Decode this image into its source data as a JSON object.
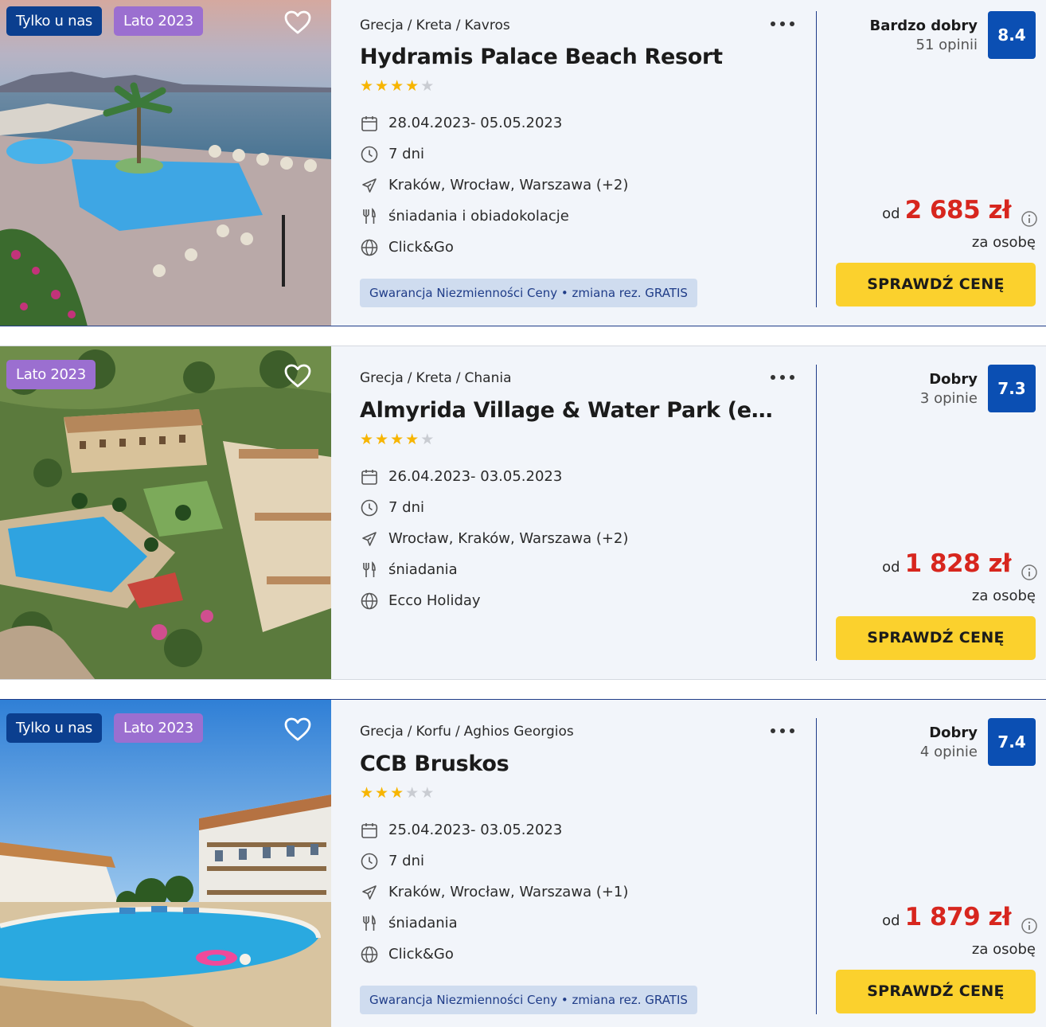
{
  "offers": [
    {
      "badges": [
        "Tylko u nas",
        "Lato 2023"
      ],
      "breadcrumb": [
        "Grecja",
        "Kreta",
        "Kavros"
      ],
      "title": "Hydramis Palace Beach Resort",
      "stars": 4,
      "dates": "28.04.2023- 05.05.2023",
      "duration": "7 dni",
      "departure": "Kraków, Wrocław, Warszawa  (+2)",
      "board": "śniadania i obiadokolacje",
      "operator": "Click&Go",
      "guarantee": "Gwarancja Niezmienności Ceny • zmiana rez. GRATIS",
      "rating_label": "Bardzo dobry",
      "rating_count": "51 opinii",
      "score": "8.4",
      "price_prefix": "od",
      "price": "2 685 zł",
      "price_note": "za osobę",
      "cta": "SPRAWDŹ CENĘ"
    },
    {
      "badges": [
        "Lato 2023"
      ],
      "breadcrumb": [
        "Grecja",
        "Kreta",
        "Chania"
      ],
      "title": "Almyrida Village & Water Park (ex. L...",
      "stars": 4,
      "dates": "26.04.2023- 03.05.2023",
      "duration": "7 dni",
      "departure": "Wrocław, Kraków, Warszawa  (+2)",
      "board": "śniadania",
      "operator": "Ecco Holiday",
      "guarantee": "",
      "rating_label": "Dobry",
      "rating_count": "3 opinie",
      "score": "7.3",
      "price_prefix": "od",
      "price": "1 828 zł",
      "price_note": "za osobę",
      "cta": "SPRAWDŹ CENĘ"
    },
    {
      "badges": [
        "Tylko u nas",
        "Lato 2023"
      ],
      "breadcrumb": [
        "Grecja",
        "Korfu",
        "Aghios Georgios"
      ],
      "title": "CCB Bruskos",
      "stars": 3,
      "dates": "25.04.2023- 03.05.2023",
      "duration": "7 dni",
      "departure": "Kraków, Wrocław, Warszawa  (+1)",
      "board": "śniadania",
      "operator": "Click&Go",
      "guarantee": "Gwarancja Niezmienności Ceny • zmiana rez. GRATIS",
      "rating_label": "Dobry",
      "rating_count": "4 opinie",
      "score": "7.4",
      "price_prefix": "od",
      "price": "1 879 zł",
      "price_note": "za osobę",
      "cta": "SPRAWDŹ CENĘ"
    }
  ],
  "colors": {
    "badge_navy": "#0b3f8f",
    "badge_purple": "#9b6fd0",
    "score_bg": "#0b4fb3",
    "price": "#d7261e",
    "cta_bg": "#fbd12d",
    "star_on": "#f7b500",
    "star_off": "#c9ccd2"
  },
  "icons": {
    "favorite": "heart-icon",
    "more": "more-dots-icon",
    "dates": "calendar-icon",
    "duration": "clock-icon",
    "departure": "plane-icon",
    "board": "cutlery-icon",
    "operator": "globe-icon",
    "price_info": "info-icon"
  }
}
